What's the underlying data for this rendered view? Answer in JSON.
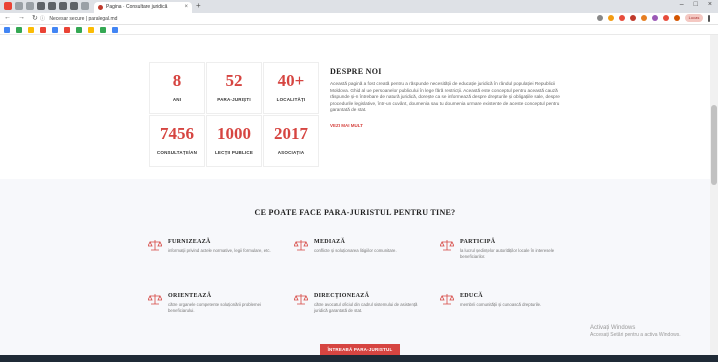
{
  "browser": {
    "tab_title": "Pagina · Consultare juridică",
    "url": "Necesar secure | paralegal.md",
    "profile_label": "Lucas",
    "window_controls": [
      "–",
      "□",
      "×"
    ]
  },
  "stats": [
    {
      "value": "8",
      "label": "ANI"
    },
    {
      "value": "52",
      "label": "PARA-JURIȘTI"
    },
    {
      "value": "40+",
      "label": "LOCALITĂȚI"
    },
    {
      "value": "7456",
      "label": "CONSULTAȚII/AN"
    },
    {
      "value": "1000",
      "label": "LECȚII PUBLICE"
    },
    {
      "value": "2017",
      "label": "ASOCIAȚIA"
    }
  ],
  "about": {
    "title": "DESPRE NOI",
    "text": "Această pagină a fost creată pentru a răspunde necesității de educație juridică în rândul populației Republicii Moldova. Ghid al ue persoanelor publicului în lege fără restricții. Această este conceptul pentru această cauză răspunde și-n întrebare de natură juridică, dorește ca se informează despre drepturile și obligațiile sale, despre procedurile legislative, într-un cuvânt, doumenia sau tu doumenia urmare existente de aceste conceptul pentru garantată de stat.",
    "link": "VEZI MAI MULT"
  },
  "services": {
    "heading": "CE POATE FACE PARA-JURISTUL PENTRU TINE?",
    "items": [
      {
        "title": "FURNIZEAZĂ",
        "desc": "informații privind actele normative, legii formulare, etc."
      },
      {
        "title": "MEDIAZĂ",
        "desc": "conflicte și soluționarea litigiilor comunitare."
      },
      {
        "title": "PARTICIPĂ",
        "desc": "la lucrul ședințelor autorităților locale în interesele beneficiarilor."
      },
      {
        "title": "ORIENTEAZĂ",
        "desc": "către organele competente soluționării problemei beneficiarului."
      },
      {
        "title": "DIRECȚIONEAZĂ",
        "desc": "către avocatul oficiul din cadrul sistemului de asistență juridică garantată de stat."
      },
      {
        "title": "EDUCĂ",
        "desc": "membrii comunității și cunoască drepturile."
      }
    ],
    "cta": "ÎNTREABĂ PARA-JURISTUL"
  },
  "watermark": {
    "line1": "Activați Windows",
    "line2": "Accesați Setări pentru a activa Windows."
  },
  "colors": {
    "accent": "#d64541",
    "section_bg": "#f7f8fb"
  }
}
